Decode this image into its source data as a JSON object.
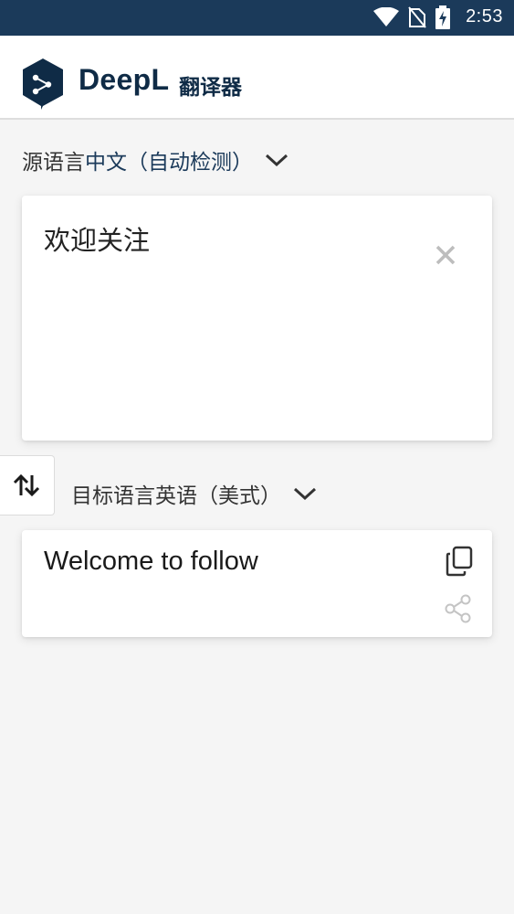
{
  "status_bar": {
    "time": "2:53",
    "icons": [
      "wifi-icon",
      "no-sim-icon",
      "battery-charging-icon"
    ]
  },
  "app": {
    "logo_word": "DeepL",
    "logo_sub": "翻译器"
  },
  "source": {
    "label": "源语言",
    "language": "中文（自动检测）",
    "text": "欢迎关注",
    "icons": [
      "chevron-down-icon",
      "close-icon"
    ]
  },
  "target": {
    "label": "目标语言",
    "language": "英语（美式）",
    "text": "Welcome to follow",
    "icons": [
      "chevron-down-icon",
      "copy-icon",
      "share-icon"
    ]
  },
  "swap": {
    "icon": "swap-vertical-icon"
  },
  "colors": {
    "status_bar": "#1b3a5a",
    "brand": "#0f2b46",
    "background": "#f5f5f5",
    "card": "#ffffff",
    "icon_muted": "#bdbdbd"
  }
}
